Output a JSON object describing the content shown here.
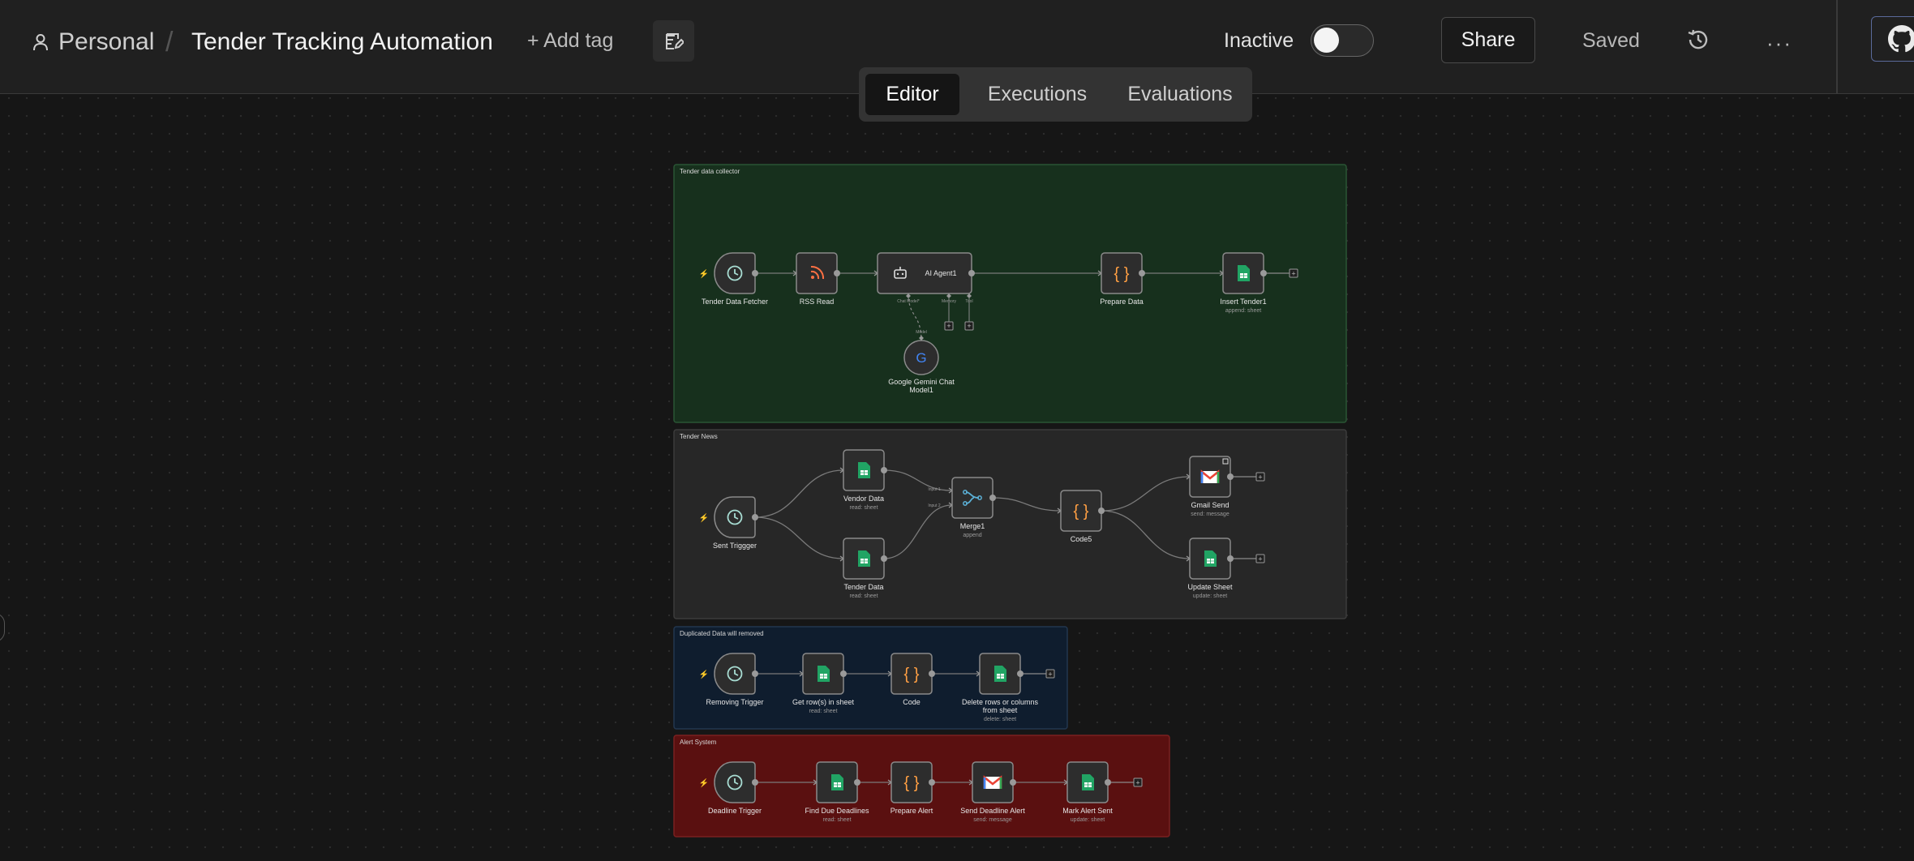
{
  "breadcrumb": {
    "owner": "Personal",
    "separator": "/",
    "title": "Tender Tracking Automation"
  },
  "header": {
    "add_tag": "+ Add tag",
    "status_label": "Inactive",
    "share": "Share",
    "saved": "Saved",
    "more": "···"
  },
  "tabs": [
    {
      "label": "Editor",
      "active": true
    },
    {
      "label": "Executions",
      "active": false
    },
    {
      "label": "Evaluations",
      "active": false
    }
  ],
  "colors": {
    "trigger_bolt": "#ff6d5a",
    "code": "#ff9f43",
    "sheets": "#21a464",
    "clock": "#a8ddd3"
  },
  "groups": [
    {
      "title": "Tender data collector",
      "color": "green",
      "nodes": [
        {
          "id": "tdf",
          "label": "Tender Data Fetcher",
          "sub": "",
          "icon": "clock-icon",
          "type": "trigger"
        },
        {
          "id": "rss",
          "label": "RSS Read",
          "sub": "",
          "icon": "rss-icon",
          "type": "node"
        },
        {
          "id": "agent",
          "label": "AI Agent1",
          "sub": "",
          "icon": "robot-icon",
          "type": "agent",
          "ports": [
            "Chat Model*",
            "Memory",
            "Tool"
          ]
        },
        {
          "id": "prep",
          "label": "Prepare Data",
          "sub": "",
          "icon": "code-icon",
          "type": "node"
        },
        {
          "id": "ins",
          "label": "Insert Tender1",
          "sub": "append: sheet",
          "icon": "sheets-icon",
          "type": "node"
        },
        {
          "id": "gem",
          "label": "Google Gemini Chat Model1",
          "sub": "",
          "icon": "google-icon",
          "type": "model",
          "port": "Model"
        }
      ]
    },
    {
      "title": "Tender News",
      "color": "gray",
      "nodes": [
        {
          "id": "st",
          "label": "Sent Triggger",
          "sub": "",
          "icon": "clock-icon",
          "type": "trigger"
        },
        {
          "id": "vd",
          "label": "Vendor Data",
          "sub": "read: sheet",
          "icon": "sheets-icon",
          "type": "node"
        },
        {
          "id": "td",
          "label": "Tender Data",
          "sub": "read: sheet",
          "icon": "sheets-icon",
          "type": "node"
        },
        {
          "id": "m1",
          "label": "Merge1",
          "sub": "append",
          "icon": "merge-icon",
          "type": "merge",
          "inputs": [
            "Input 1",
            "Input 2"
          ]
        },
        {
          "id": "c5",
          "label": "Code5",
          "sub": "",
          "icon": "code-icon",
          "type": "node"
        },
        {
          "id": "gs",
          "label": "Gmail Send",
          "sub": "send: message",
          "icon": "gmail-icon",
          "type": "node"
        },
        {
          "id": "us",
          "label": "Update Sheet",
          "sub": "update: sheet",
          "icon": "sheets-icon",
          "type": "node"
        }
      ]
    },
    {
      "title": "Duplicated Data will removed",
      "color": "blue",
      "nodes": [
        {
          "id": "rt",
          "label": "Removing Trigger",
          "sub": "",
          "icon": "clock-icon",
          "type": "trigger"
        },
        {
          "id": "gr",
          "label": "Get row(s) in sheet",
          "sub": "read: sheet",
          "icon": "sheets-icon",
          "type": "node"
        },
        {
          "id": "cd",
          "label": "Code",
          "sub": "",
          "icon": "code-icon",
          "type": "node"
        },
        {
          "id": "dr",
          "label": "Delete rows or columns from sheet",
          "sub": "delete: sheet",
          "icon": "sheets-icon",
          "type": "node"
        }
      ]
    },
    {
      "title": "Alert System",
      "color": "red",
      "nodes": [
        {
          "id": "dt",
          "label": "Deadline Trigger",
          "sub": "",
          "icon": "clock-icon",
          "type": "trigger"
        },
        {
          "id": "fd",
          "label": "Find Due Deadlines",
          "sub": "read: sheet",
          "icon": "sheets-icon",
          "type": "node"
        },
        {
          "id": "pa",
          "label": "Prepare Alert",
          "sub": "",
          "icon": "code-icon",
          "type": "node"
        },
        {
          "id": "sd",
          "label": "Send Deadline Alert",
          "sub": "send: message",
          "icon": "gmail-icon",
          "type": "node"
        },
        {
          "id": "ma",
          "label": "Mark Alert Sent",
          "sub": "update: sheet",
          "icon": "sheets-icon",
          "type": "node"
        }
      ]
    }
  ]
}
